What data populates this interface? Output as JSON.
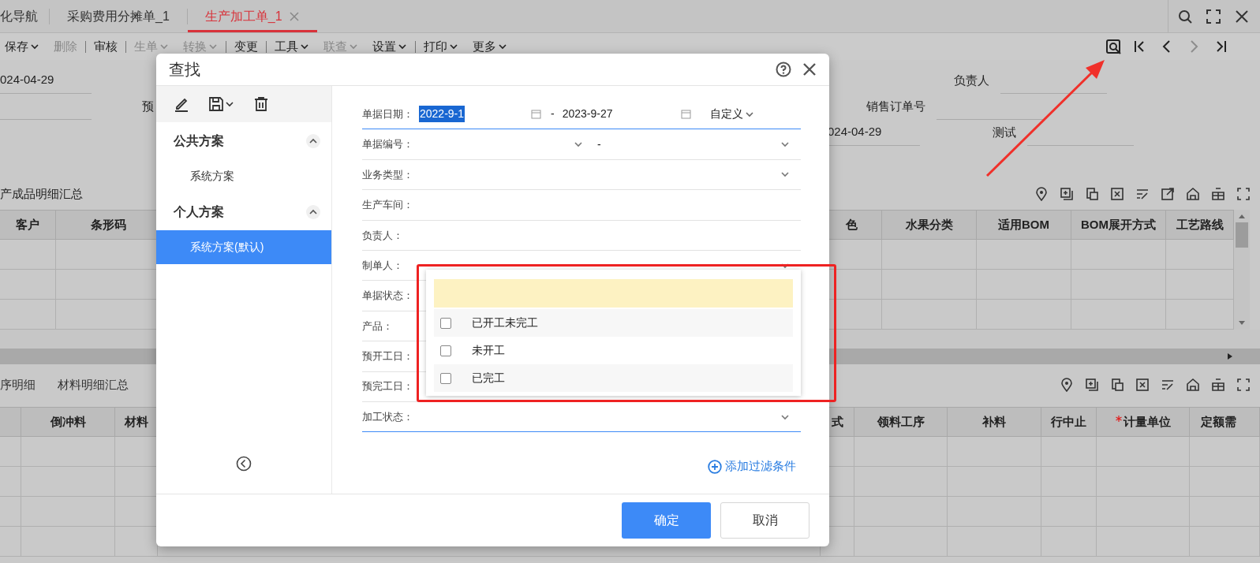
{
  "tabs": [
    {
      "label": "化导航",
      "selected": false,
      "closable": false
    },
    {
      "label": "采购费用分摊单_1",
      "selected": false,
      "closable": false
    },
    {
      "label": "生产加工单_1",
      "selected": true,
      "closable": true
    }
  ],
  "toolbar": [
    {
      "kind": "button",
      "label": "保存",
      "dropdown": true,
      "disabled": false
    },
    {
      "kind": "button",
      "label": "删除",
      "dropdown": false,
      "disabled": true
    },
    {
      "kind": "divider"
    },
    {
      "kind": "button",
      "label": "审核",
      "dropdown": false,
      "disabled": false
    },
    {
      "kind": "divider"
    },
    {
      "kind": "button",
      "label": "生单",
      "dropdown": true,
      "disabled": true
    },
    {
      "kind": "button",
      "label": "转换",
      "dropdown": true,
      "disabled": true
    },
    {
      "kind": "divider"
    },
    {
      "kind": "button",
      "label": "变更",
      "dropdown": false,
      "disabled": false
    },
    {
      "kind": "divider"
    },
    {
      "kind": "button",
      "label": "工具",
      "dropdown": true,
      "disabled": false
    },
    {
      "kind": "button",
      "label": "联查",
      "dropdown": true,
      "disabled": true
    },
    {
      "kind": "button",
      "label": "设置",
      "dropdown": true,
      "disabled": false
    },
    {
      "kind": "divider"
    },
    {
      "kind": "button",
      "label": "打印",
      "dropdown": true,
      "disabled": false
    },
    {
      "kind": "button",
      "label": "更多",
      "dropdown": true,
      "disabled": false
    }
  ],
  "record_nav": [
    {
      "kind": "locate",
      "disabled": false
    },
    {
      "kind": "first",
      "disabled": false
    },
    {
      "kind": "prev",
      "disabled": false
    },
    {
      "kind": "next",
      "disabled": true
    },
    {
      "kind": "last",
      "disabled": false
    }
  ],
  "header_fields": {
    "date_left": "024-04-29",
    "cut_label": "预",
    "date_right": "024-04-29",
    "labels": [
      "负责人",
      "销售订单号",
      "测试"
    ]
  },
  "upper_section": {
    "title": "产成品明细汇总",
    "columns": [
      {
        "label": "客户",
        "required": false
      },
      {
        "label": "条形码",
        "required": false
      },
      {
        "label": "色",
        "required": false
      },
      {
        "label": "水果分类",
        "required": false
      },
      {
        "label": "适用BOM",
        "required": false
      },
      {
        "label": "BOM展开方式",
        "required": false
      },
      {
        "label": "工艺路线",
        "required": false
      }
    ]
  },
  "lower_section": {
    "tabs": [
      {
        "label": "序明细",
        "selected": false
      },
      {
        "label": "材料明细汇总",
        "selected": false
      }
    ],
    "columns": [
      {
        "label": "倒冲料",
        "required": false
      },
      {
        "label": "材料",
        "required": false
      },
      {
        "label": "式",
        "required": false
      },
      {
        "label": "领料工序",
        "required": false
      },
      {
        "label": "补料",
        "required": false
      },
      {
        "label": "行中止",
        "required": false
      },
      {
        "label": "计量单位",
        "required": true
      },
      {
        "label": "定额需",
        "required": false
      }
    ]
  },
  "dialog": {
    "title": "查找",
    "scheme_groups": [
      {
        "title": "公共方案",
        "expanded": true,
        "items": [
          {
            "label": "系统方案",
            "selected": false
          }
        ]
      },
      {
        "title": "个人方案",
        "expanded": true,
        "items": [
          {
            "label": "系统方案(默认)",
            "selected": true
          }
        ]
      }
    ],
    "filters": [
      {
        "label": "单据日期：",
        "kind": "date_range",
        "from": "2022-9-1",
        "from_selected": true,
        "separator": "-",
        "to": "2023-9-27",
        "mode": "自定义",
        "focused": true
      },
      {
        "label": "单据编号：",
        "kind": "range_select",
        "separator": "-",
        "focused": false
      },
      {
        "label": "业务类型：",
        "kind": "select",
        "focused": false
      },
      {
        "label": "生产车间：",
        "kind": "text",
        "focused": false
      },
      {
        "label": "负责人：",
        "kind": "text",
        "focused": false
      },
      {
        "label": "制单人：",
        "kind": "select",
        "focused": false
      },
      {
        "label": "单据状态：",
        "kind": "text",
        "focused": false
      },
      {
        "label": "产品：",
        "kind": "text",
        "focused": false
      },
      {
        "label": "预开工日：",
        "kind": "text",
        "focused": false
      },
      {
        "label": "预完工日：",
        "kind": "text",
        "focused": false
      },
      {
        "label": "加工状态：",
        "kind": "select",
        "focused": true
      }
    ],
    "status_options": [
      {
        "label": "已开工未完工",
        "checked": false
      },
      {
        "label": "未开工",
        "checked": false
      },
      {
        "label": "已完工",
        "checked": false
      }
    ],
    "add_filter": "添加过滤条件",
    "buttons": [
      {
        "label": "确定",
        "kind": "primary"
      },
      {
        "label": "取消",
        "kind": "secondary"
      }
    ]
  }
}
